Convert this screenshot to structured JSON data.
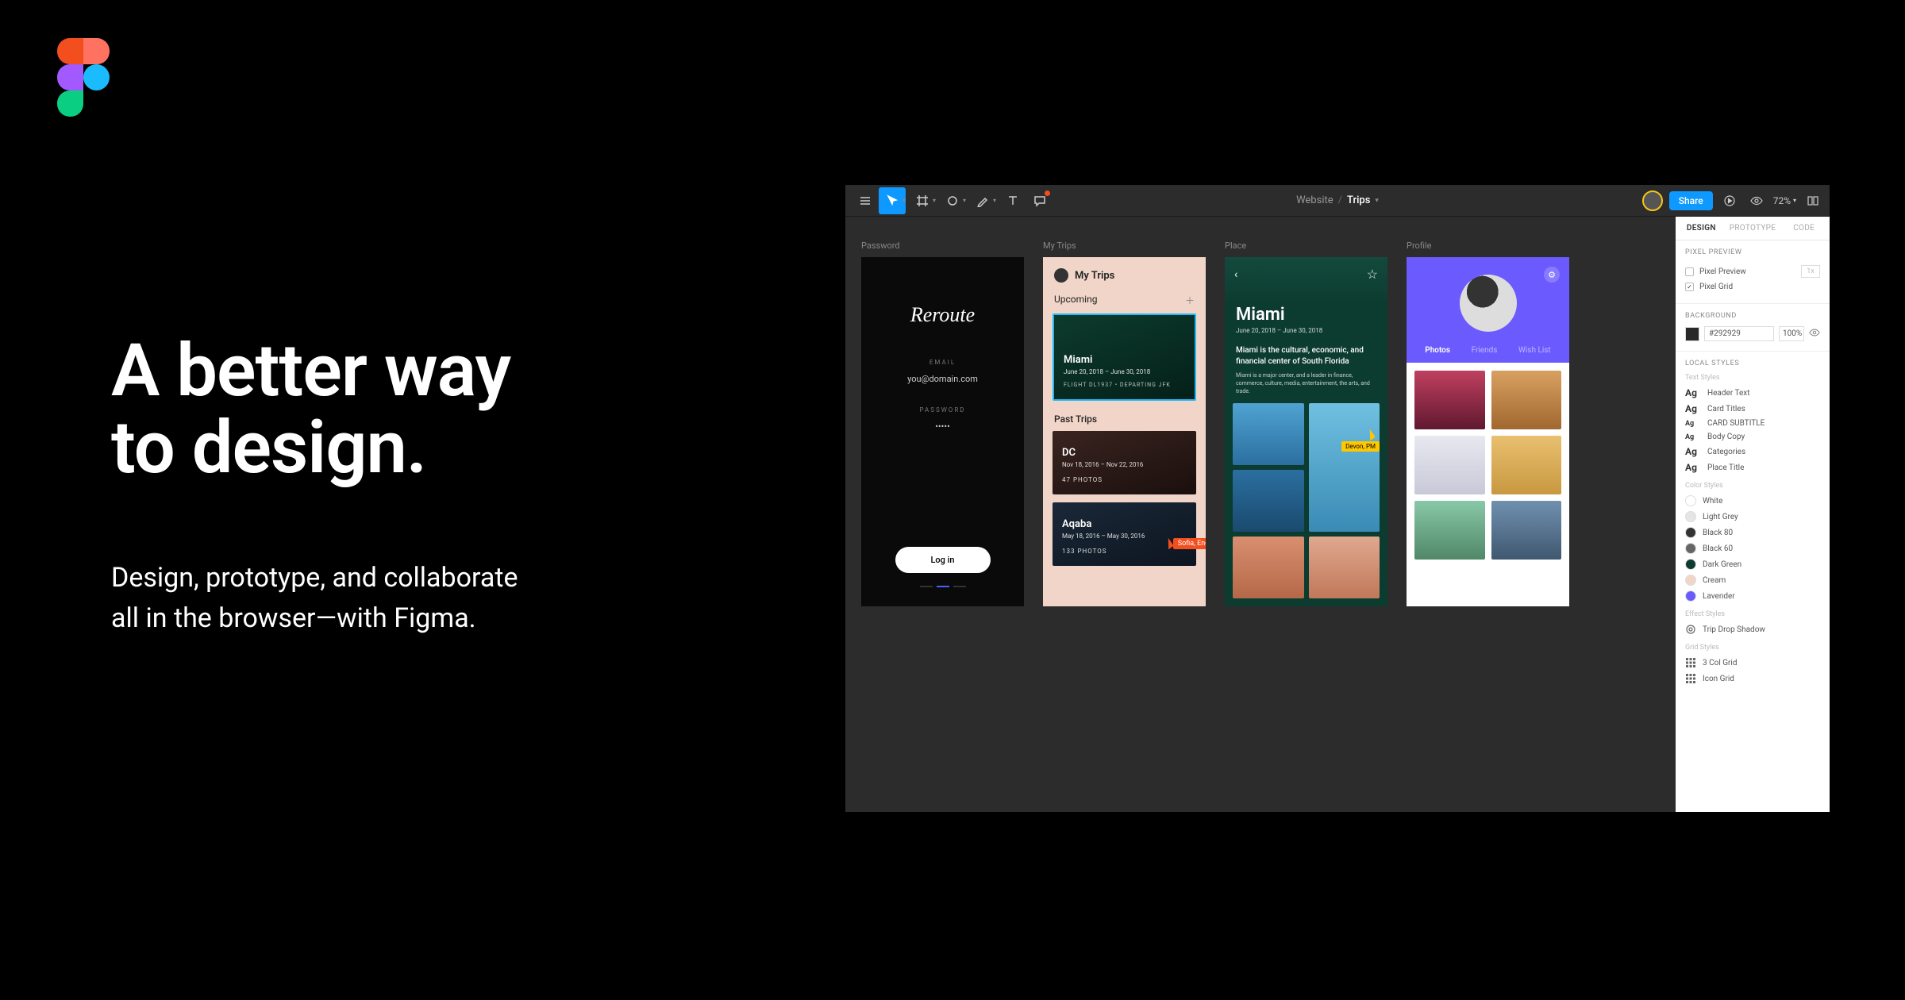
{
  "hero": {
    "title_line1": "A better way",
    "title_line2": "to design.",
    "subtitle_line1": "Design, prototype, and collaborate",
    "subtitle_line2": "all in the browser—with Figma."
  },
  "toolbar": {
    "breadcrumb_project": "Website",
    "breadcrumb_file": "Trips",
    "share": "Share",
    "zoom": "72%"
  },
  "frames": {
    "f1": {
      "label": "Password",
      "brand": "Reroute",
      "email_label": "EMAIL",
      "email_value": "you@domain.com",
      "password_label": "PASSWORD",
      "password_value": "•••••",
      "login": "Log in"
    },
    "f2": {
      "label": "My Trips",
      "header": "My Trips",
      "section_upcoming": "Upcoming",
      "section_past": "Past Trips",
      "miami": {
        "city": "Miami",
        "dates": "June 20, 2018 – June 30, 2018",
        "flight": "FLIGHT DL1937 • DEPARTING JFK"
      },
      "dc": {
        "city": "DC",
        "dates": "Nov 18, 2016 – Nov 22, 2016",
        "photos": "47 PHOTOS"
      },
      "aqaba": {
        "city": "Aqaba",
        "dates": "May 18, 2016 – May 30, 2016",
        "photos": "133 PHOTOS"
      },
      "cursor_sofia": "Sofia, Engineer"
    },
    "f3": {
      "label": "Place",
      "title": "Miami",
      "dates": "June 20, 2018 – June 30, 2018",
      "desc1": "Miami is the cultural, economic, and financial center of South Florida",
      "desc2": "Miami is a major center, and a leader in finance, commerce, culture, media, entertainment, the arts, and trade.",
      "cursor_devon": "Devon, PM"
    },
    "f4": {
      "label": "Profile",
      "tabs": [
        "Photos",
        "Friends",
        "Wish List"
      ]
    }
  },
  "panel": {
    "tabs": [
      "DESIGN",
      "PROTOTYPE",
      "CODE"
    ],
    "pixel_preview": {
      "header": "PIXEL PREVIEW",
      "row1": "Pixel Preview",
      "row1_val": "1x",
      "row2": "Pixel Grid"
    },
    "background": {
      "header": "BACKGROUND",
      "hex": "#292929",
      "opacity": "100%"
    },
    "local_styles": {
      "header": "LOCAL STYLES",
      "text_cat": "Text Styles",
      "text_styles": [
        "Header Text",
        "Card Titles",
        "CARD SUBTITLE",
        "Body Copy",
        "Categories",
        "Place Title"
      ],
      "color_cat": "Color Styles",
      "color_styles": [
        {
          "name": "White",
          "hex": "#ffffff"
        },
        {
          "name": "Light Grey",
          "hex": "#e5e5e5"
        },
        {
          "name": "Black 80",
          "hex": "#333333"
        },
        {
          "name": "Black 60",
          "hex": "#666666"
        },
        {
          "name": "Dark Green",
          "hex": "#0c3b30"
        },
        {
          "name": "Cream",
          "hex": "#f0d5c8"
        },
        {
          "name": "Lavender",
          "hex": "#6b5bff"
        }
      ],
      "effect_cat": "Effect Styles",
      "effect_styles": [
        "Trip Drop Shadow"
      ],
      "grid_cat": "Grid Styles",
      "grid_styles": [
        "3 Col Grid",
        "Icon Grid"
      ]
    }
  }
}
